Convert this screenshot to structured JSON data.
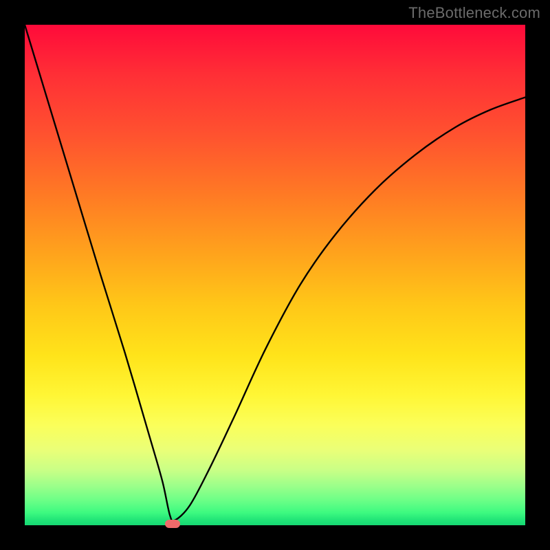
{
  "watermark": "TheBottleneck.com",
  "chart_data": {
    "type": "line",
    "title": "",
    "xlabel": "",
    "ylabel": "",
    "xlim": [
      0,
      1
    ],
    "ylim": [
      0,
      1
    ],
    "grid": false,
    "legend": false,
    "annotations": [],
    "marker": {
      "x": 0.295,
      "y": 0.0
    },
    "series": [
      {
        "name": "curve",
        "x": [
          0.0,
          0.05,
          0.1,
          0.15,
          0.2,
          0.25,
          0.275,
          0.29,
          0.3,
          0.33,
          0.37,
          0.42,
          0.48,
          0.55,
          0.62,
          0.7,
          0.78,
          0.86,
          0.93,
          1.0
        ],
        "y": [
          1.0,
          0.835,
          0.67,
          0.505,
          0.345,
          0.175,
          0.088,
          0.02,
          0.01,
          0.04,
          0.115,
          0.22,
          0.35,
          0.48,
          0.58,
          0.67,
          0.74,
          0.795,
          0.83,
          0.855
        ]
      }
    ]
  }
}
